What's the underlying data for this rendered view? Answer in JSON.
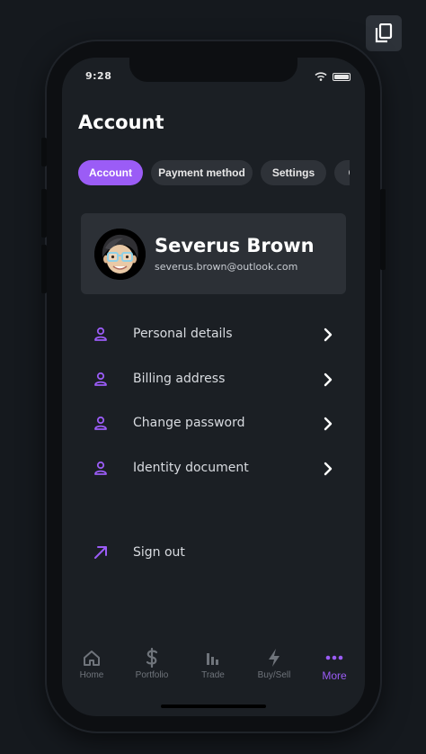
{
  "status_bar": {
    "time": "9:28"
  },
  "page": {
    "title": "Account"
  },
  "tabs": [
    {
      "label": "Account",
      "active": true
    },
    {
      "label": "Payment method",
      "active": false
    },
    {
      "label": "Settings",
      "active": false
    },
    {
      "label": "C",
      "active": false
    }
  ],
  "profile": {
    "name": "Severus Brown",
    "email": "severus.brown@outlook.com"
  },
  "menu": {
    "items": [
      {
        "label": "Personal details",
        "icon": "user-icon"
      },
      {
        "label": "Billing address",
        "icon": "user-icon"
      },
      {
        "label": "Change password",
        "icon": "user-icon"
      },
      {
        "label": "Identity document",
        "icon": "user-icon"
      }
    ],
    "sign_out": {
      "label": "Sign out",
      "icon": "arrow-up-right-icon"
    }
  },
  "bottom_nav": [
    {
      "label": "Home",
      "icon": "home-icon"
    },
    {
      "label": "Portfolio",
      "icon": "dollar-icon"
    },
    {
      "label": "Trade",
      "icon": "bar-chart-icon"
    },
    {
      "label": "Buy/Sell",
      "icon": "lightning-icon"
    },
    {
      "label": "More",
      "icon": "more-dots-icon",
      "active": true
    }
  ],
  "colors": {
    "accent": "#9b5cf6",
    "background": "#1b1f24",
    "card": "#2c3036",
    "tab_inactive": "#2e3238"
  }
}
